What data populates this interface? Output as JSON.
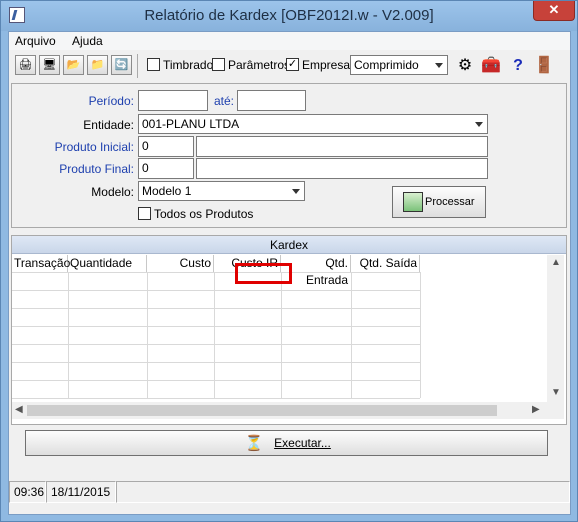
{
  "window": {
    "title": "Relatório de Kardex [OBF2012I.w - V2.009]",
    "close_label": "✕"
  },
  "menu": {
    "items": [
      "Arquivo",
      "Ajuda"
    ]
  },
  "toolbar": {
    "options": [
      {
        "label": "Timbrado",
        "checked": false
      },
      {
        "label": "Parâmetros",
        "checked": false
      },
      {
        "label": "Empresa",
        "checked": true
      }
    ],
    "format_value": "Comprimido"
  },
  "form": {
    "periodo_label": "Período:",
    "periodo_start": "",
    "ate_label": "até:",
    "periodo_end": "",
    "entidade_label": "Entidade:",
    "entidade_value": "001-PLANU LTDA",
    "produto_inicial_label": "Produto Inicial:",
    "produto_inicial_value": "0",
    "produto_final_label": "Produto Final:",
    "produto_final_value": "0",
    "modelo_label": "Modelo:",
    "modelo_value": "Modelo 1",
    "todos_produtos_label": "Todos os Produtos",
    "process_label": "Processar"
  },
  "kardex": {
    "title": "Kardex",
    "columns": [
      "Transação",
      "Quantidade",
      "Custo",
      "Custo IR",
      "Qtd. Entrada",
      "Qtd. Saída"
    ]
  },
  "execute_label": "Executar...",
  "status": {
    "time": "09:36",
    "date": "18/11/2015"
  }
}
